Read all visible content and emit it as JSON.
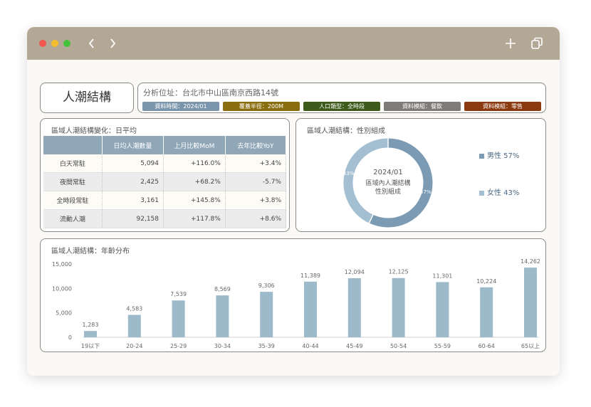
{
  "colors": {
    "titlebar": "#b3a796",
    "close": "#f2564f",
    "minimize": "#f5be2e",
    "maximize": "#44c23a",
    "table_header": "#8fa7b7",
    "bar": "#9dbacb",
    "donut_male": "#7b9ab3",
    "donut_female": "#a5bfd2"
  },
  "browser": {
    "back_icon": "chevron-left-icon",
    "forward_icon": "chevron-right-icon",
    "new_tab_icon": "plus-icon",
    "tabs_icon": "copy-icon"
  },
  "header": {
    "title": "人潮結構",
    "address": "分析位址：台北市中山區南京西路14號",
    "tags": [
      {
        "text": "資料時間：2024/01",
        "color": "#7b95ad"
      },
      {
        "text": "覆蓋半徑：200M",
        "color": "#8a6d0e"
      },
      {
        "text": "人口類型：全時段",
        "color": "#3e5b1c"
      },
      {
        "text": "資料模組：餐飲",
        "color": "#7f7b78"
      },
      {
        "text": "資料模組：零售",
        "color": "#8b3a10"
      }
    ]
  },
  "table_panel": {
    "title": "區域人潮結構變化：日平均",
    "columns": [
      "",
      "日均人潮數量",
      "上月比較MoM",
      "去年比較YoY"
    ],
    "rows": [
      {
        "label": "白天常駐",
        "count": "5,094",
        "mom": "+116.0%",
        "yoy": "+3.4%"
      },
      {
        "label": "夜間常駐",
        "count": "2,425",
        "mom": "+68.2%",
        "yoy": "-5.7%"
      },
      {
        "label": "全時段常駐",
        "count": "3,161",
        "mom": "+145.8%",
        "yoy": "+3.8%"
      },
      {
        "label": "流動人潮",
        "count": "92,158",
        "mom": "+117.8%",
        "yoy": "+8.6%"
      }
    ]
  },
  "gender_panel": {
    "title": "區域人潮結構：性別組成",
    "center_line1": "2024/01",
    "center_line2": "區域內人潮結構",
    "center_line3": "性別組成",
    "male_label": "男性 57%",
    "female_label": "女性 43%",
    "male_pct_label": "57%",
    "female_pct_label": "43%",
    "male_share": 0.57,
    "female_share": 0.43
  },
  "age_panel": {
    "title": "區域人潮結構：年齡分布"
  },
  "chart_data": {
    "type": "bar",
    "title": "區域人潮結構：年齡分布",
    "categories": [
      "19以下",
      "20-24",
      "25-29",
      "30-34",
      "35-39",
      "40-44",
      "45-49",
      "50-54",
      "55-59",
      "60-64",
      "65以上"
    ],
    "values": [
      1283,
      4583,
      7539,
      8569,
      9306,
      11389,
      12094,
      12125,
      11301,
      10224,
      14262
    ],
    "value_labels": [
      "1,283",
      "4,583",
      "7,539",
      "8,569",
      "9,306",
      "11,389",
      "12,094",
      "12,125",
      "11,301",
      "10,224",
      "14,262"
    ],
    "yticks": [
      0,
      5000,
      10000,
      15000
    ],
    "ytick_labels": [
      "0",
      "5,000",
      "10,000",
      "15,000"
    ],
    "ylim": [
      0,
      15000
    ],
    "grid": false
  }
}
